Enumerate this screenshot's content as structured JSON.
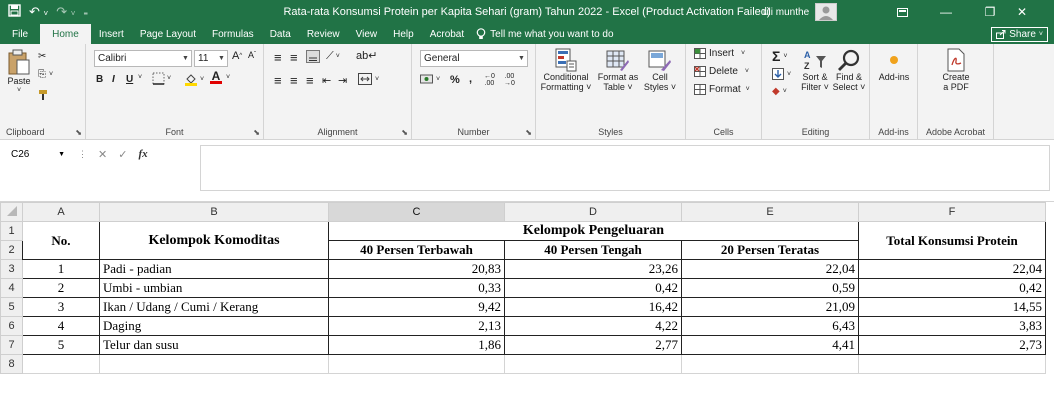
{
  "window": {
    "title": "Rata-rata Konsumsi Protein per Kapita Sehari (gram) Tahun 2022  -  Excel (Product Activation Failed)",
    "user": "uli munthe"
  },
  "tabs": [
    "File",
    "Home",
    "Insert",
    "Page Layout",
    "Formulas",
    "Data",
    "Review",
    "View",
    "Help",
    "Acrobat"
  ],
  "tellme": "Tell me what you want to do",
  "share_label": "Share",
  "ribbon": {
    "clipboard": {
      "paste": "Paste",
      "label": "Clipboard"
    },
    "font": {
      "name": "Calibri",
      "size": "11",
      "bold": "B",
      "italic": "I",
      "underline": "U",
      "label": "Font"
    },
    "alignment": {
      "label": "Alignment"
    },
    "number": {
      "format": "General",
      "label": "Number"
    },
    "styles": {
      "conditional": [
        "Conditional",
        "Formatting ˅"
      ],
      "format_table": [
        "Format as",
        "Table ˅"
      ],
      "cell_styles": [
        "Cell",
        "Styles ˅"
      ],
      "label": "Styles"
    },
    "cells": {
      "insert": "Insert",
      "delete": "Delete",
      "format": "Format",
      "label": "Cells"
    },
    "editing": {
      "sort": [
        "Sort &",
        "Filter ˅"
      ],
      "find": [
        "Find &",
        "Select ˅"
      ],
      "label": "Editing"
    },
    "addins": {
      "btn": "Add-ins",
      "label": "Add-ins"
    },
    "acrobat": {
      "btn": [
        "Create",
        "a PDF"
      ],
      "label": "Adobe Acrobat"
    }
  },
  "formula_bar": {
    "name_box": "C26",
    "fx": "fx",
    "value": ""
  },
  "sheet": {
    "columns": [
      "A",
      "B",
      "C",
      "D",
      "E",
      "F"
    ],
    "rows": [
      "1",
      "2",
      "3",
      "4",
      "5",
      "6",
      "7",
      "8"
    ],
    "header": {
      "no": "No.",
      "kelompok": "Kelompok Komoditas",
      "pengeluaran": "Kelompok Pengeluaran",
      "c": "40 Persen Terbawah",
      "d": "40 Persen Tengah",
      "e": "20 Persen Teratas",
      "total": "Total Konsumsi Protein"
    },
    "data": [
      {
        "no": "1",
        "name": "Padi - padian",
        "c": "20,83",
        "d": "23,26",
        "e": "22,04",
        "f": "22,04"
      },
      {
        "no": "2",
        "name": "Umbi - umbian",
        "c": "0,33",
        "d": "0,42",
        "e": "0,59",
        "f": "0,42"
      },
      {
        "no": "3",
        "name": "Ikan / Udang / Cumi / Kerang",
        "c": "9,42",
        "d": "16,42",
        "e": "21,09",
        "f": "14,55"
      },
      {
        "no": "4",
        "name": "Daging",
        "c": "2,13",
        "d": "4,22",
        "e": "6,43",
        "f": "3,83"
      },
      {
        "no": "5",
        "name": "Telur dan susu",
        "c": "1,86",
        "d": "2,77",
        "e": "4,41",
        "f": "2,73"
      }
    ]
  },
  "colors": {
    "excel_green": "#217346",
    "ribbon_bg": "#f3f3f3",
    "grid_line": "#d4d4d4"
  }
}
